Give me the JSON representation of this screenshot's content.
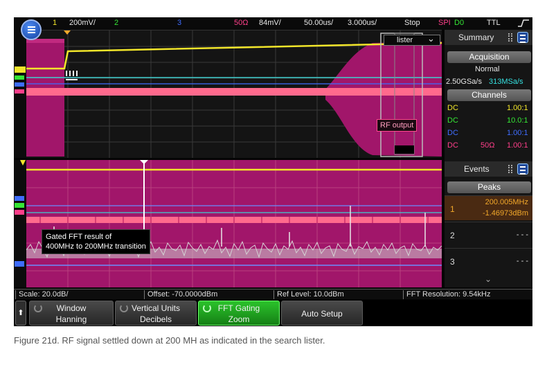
{
  "status_bar": {
    "ch1_num": "1",
    "ch1_scale": "200mV/",
    "ch2_num": "2",
    "ch3_num": "3",
    "ch4_impedance": "50Ω",
    "ch4_scale": "84mV/",
    "timebase": "50.00us/",
    "delay": "3.000us/",
    "run_state": "Stop",
    "bus_protocol": "SPI",
    "bus_channel": "D0",
    "trigger_level": "TTL",
    "ch1_color": "#f2e62a",
    "ch2_color": "#35e635",
    "ch3_color": "#3f6dff",
    "ch4_color": "#ff3f8a"
  },
  "upper_overlay": {
    "lister_label": "lister",
    "lister_arrow": "⌄",
    "rf_output_label": "RF output"
  },
  "side_panel": {
    "summary_tab": "Summary",
    "acquisition_header": "Acquisition",
    "acq_mode": "Normal",
    "sample_rate": "2.50GSa/s",
    "sample_rate_alt": "313MSa/s",
    "channels_header": "Channels",
    "channels": [
      {
        "coupling": "DC",
        "impedance": "",
        "ratio": "1.00:1",
        "color": "#f2e62a"
      },
      {
        "coupling": "DC",
        "impedance": "",
        "ratio": "10.0:1",
        "color": "#35e635"
      },
      {
        "coupling": "DC",
        "impedance": "",
        "ratio": "1.00:1",
        "color": "#3f6dff"
      },
      {
        "coupling": "DC",
        "impedance": "50Ω",
        "ratio": "1.00:1",
        "color": "#ff3f8a"
      }
    ],
    "events_tab": "Events",
    "peaks_header": "Peaks",
    "events": [
      {
        "num": "1",
        "freq": "200.005MHz",
        "level": "-1.46973dBm"
      },
      {
        "num": "2",
        "value": "- - -"
      },
      {
        "num": "3",
        "value": "- - -"
      }
    ],
    "more_arrow": "⌄"
  },
  "fft_annotation": {
    "line1": "Gated FFT result of",
    "line2": "400MHz to 200MHz transition"
  },
  "info_bar": {
    "scale": "Scale: 20.0dB/",
    "offset": "Offset: -70.0000dBm",
    "ref_level": "Ref Level: 10.0dBm",
    "fft_resolution": "FFT Resolution: 9.54kHz"
  },
  "softkeys": {
    "home_glyph": "⬆",
    "window_label": "Window",
    "window_value": "Hanning",
    "vertical_units_label": "Vertical Units",
    "vertical_units_value": "Decibels",
    "fft_gating_label": "FFT Gating",
    "fft_gating_value": "Zoom",
    "auto_setup_label": "Auto Setup"
  },
  "caption": "Figure 21d. RF signal settled down at 200 MH as indicated in the search lister."
}
